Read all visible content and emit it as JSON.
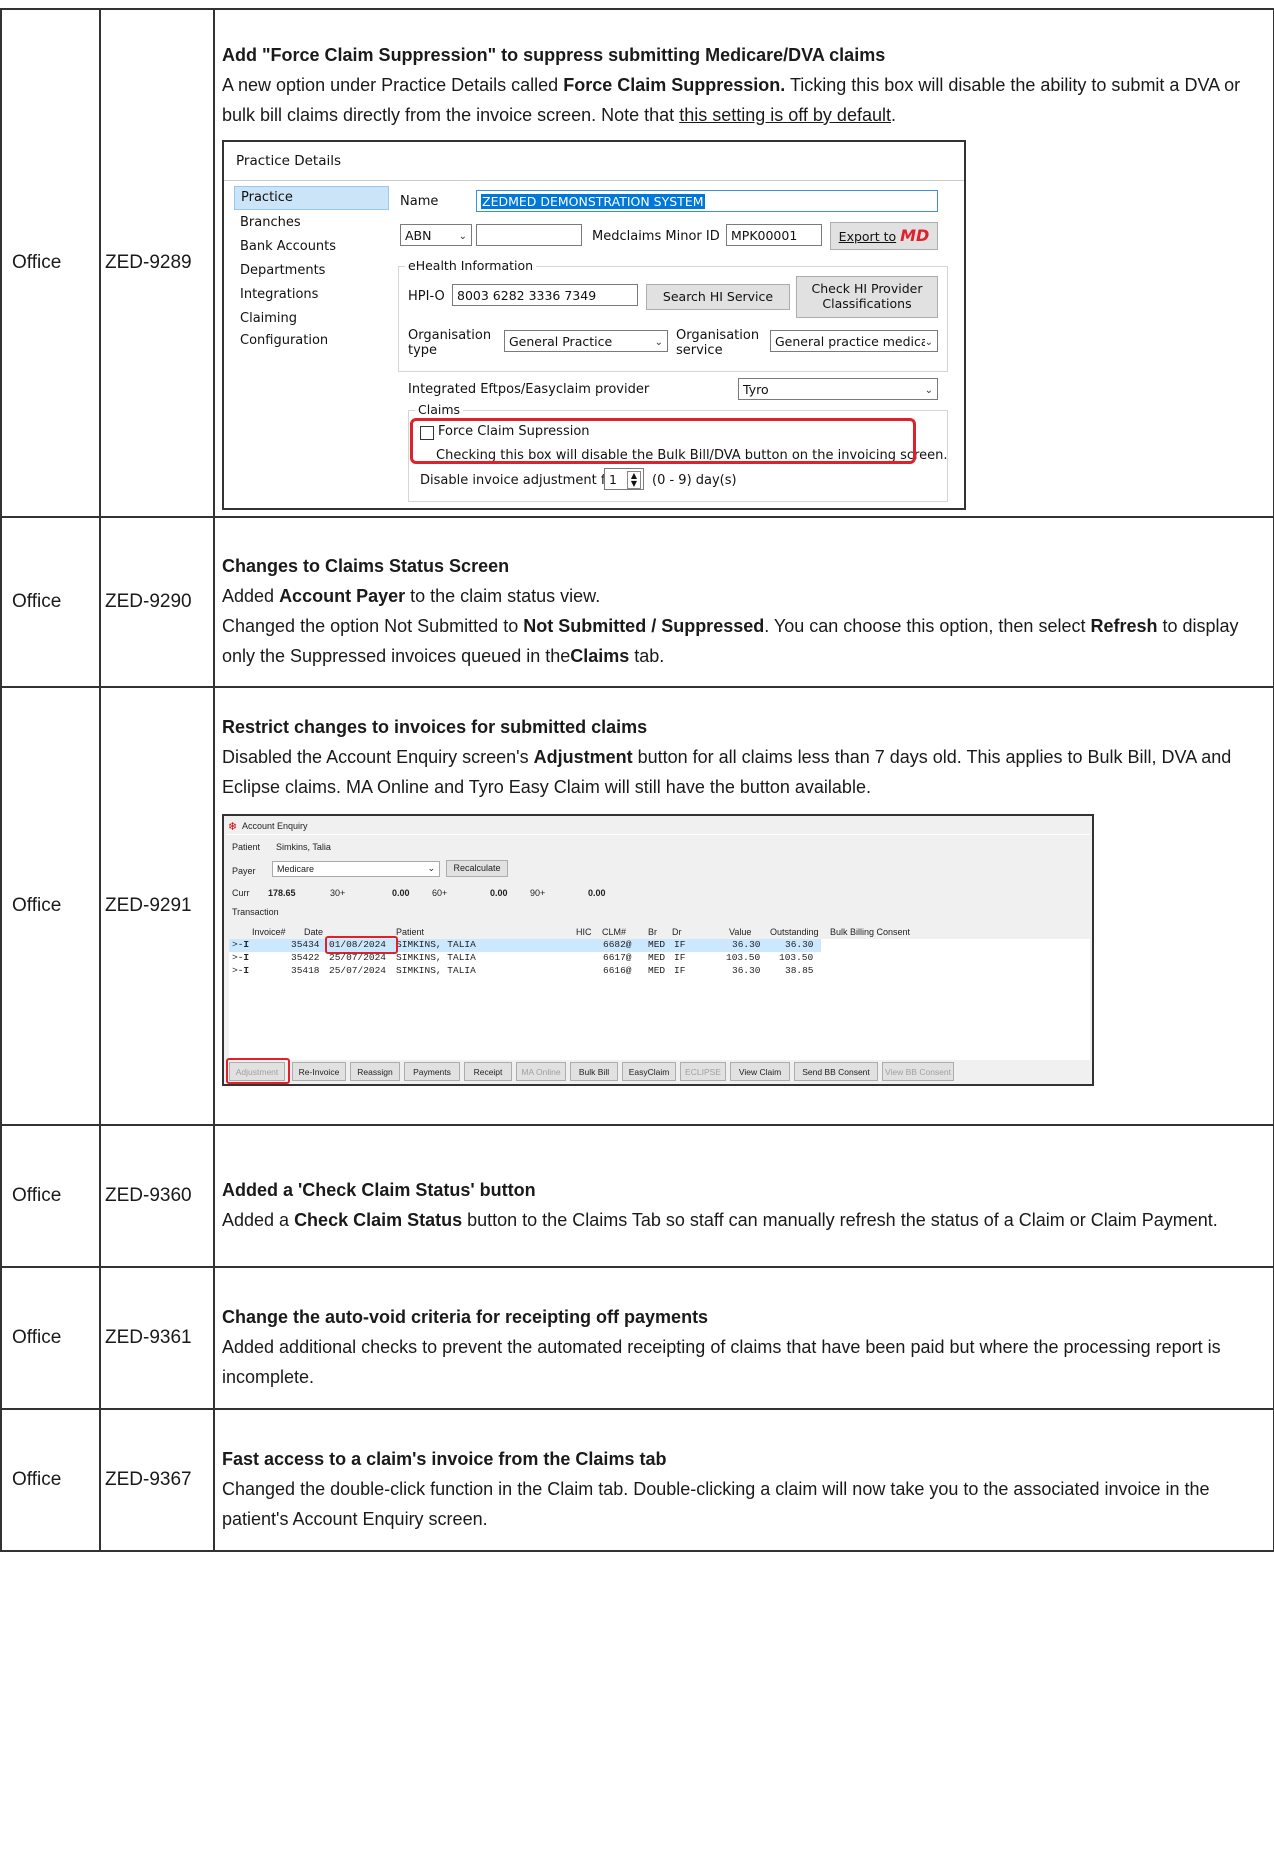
{
  "rows": [
    {
      "category": "Office",
      "id": "ZED-9289",
      "title": "Add \"Force Claim Suppression\" to suppress submitting Medicare/DVA claims",
      "text_a": "A new option under Practice Details called ",
      "bold_a": "Force Claim Suppression.",
      "text_b": " Ticking this box will disable the ability to submit a DVA or bulk bill claims directly from the invoice screen. Note that ",
      "underline": "this setting is off by default",
      "text_c": "."
    },
    {
      "category": "Office",
      "id": "ZED-9290",
      "title": "Changes to Claims Status Screen",
      "text_a": "Added ",
      "bold_a": "Account Payer",
      "text_b": " to the claim status view.",
      "text_c": "Changed the option Not Submitted to ",
      "bold_b": "Not Submitted / Suppressed",
      "text_d": ". You can choose this option, then select ",
      "bold_c": "Refresh",
      "text_e": " to display only the Suppressed invoices queued in the",
      "bold_d": "Claims",
      "text_f": " tab."
    },
    {
      "category": "Office",
      "id": "ZED-9291",
      "title": "Restrict changes to invoices for submitted claims",
      "text_a": "Disabled the Account Enquiry screen's ",
      "bold_a": "Adjustment",
      "text_b": " button for all claims less than 7 days old. This applies to Bulk Bill, DVA and Eclipse claims. MA Online and Tyro Easy Claim will still have the button available."
    },
    {
      "category": "Office",
      "id": "ZED-9360",
      "title": "Added a 'Check Claim Status' button",
      "text_a": "Added a ",
      "bold_a": "Check Claim Status",
      "text_b": " button to the Claims Tab so staff can manually refresh the status of a Claim or Claim Payment."
    },
    {
      "category": "Office",
      "id": "ZED-9361",
      "title": "Change the auto-void criteria for receipting off payments",
      "text_a": "Added additional checks to prevent the automated receipting of claims that have been paid but where the processing report is incomplete."
    },
    {
      "category": "Office",
      "id": "ZED-9367",
      "title": "Fast access to a claim's invoice from the Claims tab",
      "text_a": "Changed the double-click function in the Claim tab. Double-clicking a claim will now take you to the associated invoice in the patient's Account Enquiry screen."
    }
  ],
  "practice_dialog": {
    "title": "Practice Details",
    "nav": [
      "Practice",
      "Branches",
      "Bank Accounts",
      "Departments",
      "Integrations",
      "Claiming Configuration"
    ],
    "name_label": "Name",
    "name_value": "ZEDMED DEMONSTRATION SYSTEM",
    "abn_label": "ABN",
    "medclaims_label": "Medclaims Minor ID",
    "medclaims_value": "MPK00001",
    "export_label": "Export to",
    "export_logo": "MD",
    "ehealth_caption": "eHealth Information",
    "hpio_label": "HPI-O",
    "hpio_value": "8003 6282 3336 7349",
    "search_hi": "Search HI Service",
    "check_hi_1": "Check HI Provider",
    "check_hi_2": "Classifications",
    "org_type_1": "Organisation",
    "org_type_2": "type",
    "org_type_value": "General Practice",
    "org_service_1": "Organisation",
    "org_service_2": "service",
    "org_service_value": "General practice medica",
    "eftpos_label": "Integrated Eftpos/Easyclaim provider",
    "eftpos_value": "Tyro",
    "claims_caption": "Claims",
    "force_label": "Force Claim Supression",
    "force_note": "Checking this box will disable the Bulk Bill/DVA button on the invoicing screen.",
    "disable_label": "Disable invoice adjustment for",
    "disable_value": "1",
    "disable_range": "(0 - 9) day(s)"
  },
  "account_enquiry": {
    "title": "Account Enquiry",
    "patient_label": "Patient",
    "patient_value": "Simkins, Talia",
    "payer_label": "Payer",
    "payer_value": "Medicare",
    "recalculate": "Recalculate",
    "curr_label": "Curr",
    "curr_value": "178.65",
    "d30_label": "30+",
    "d30_value": "0.00",
    "d60_label": "60+",
    "d60_value": "0.00",
    "d90_label": "90+",
    "d90_value": "0.00",
    "transaction_label": "Transaction",
    "headers": [
      "Invoice#",
      "Date",
      "Patient",
      "HIC",
      "CLM#",
      "Br",
      "Dr",
      "Value",
      "Outstanding",
      "Bulk Billing Consent"
    ],
    "rows": [
      {
        "invoice": "35434",
        "date": "01/08/2024",
        "patient": "SIMKINS, TALIA",
        "clm": "6682@",
        "br": "MED",
        "dr": "IF",
        "value": "36.30",
        "outstanding": "36.30"
      },
      {
        "invoice": "35422",
        "date": "25/07/2024",
        "patient": "SIMKINS, TALIA",
        "clm": "6617@",
        "br": "MED",
        "dr": "IF",
        "value": "103.50",
        "outstanding": "103.50"
      },
      {
        "invoice": "35418",
        "date": "25/07/2024",
        "patient": "SIMKINS, TALIA",
        "clm": "6616@",
        "br": "MED",
        "dr": "IF",
        "value": "36.30",
        "outstanding": "38.85"
      }
    ],
    "buttons": [
      "Adjustment",
      "Re-Invoice",
      "Reassign",
      "Payments",
      "Receipt",
      "MA Online",
      "Bulk Bill",
      "EasyClaim",
      "ECLIPSE",
      "View Claim",
      "Send BB Consent",
      "View BB Consent"
    ]
  }
}
